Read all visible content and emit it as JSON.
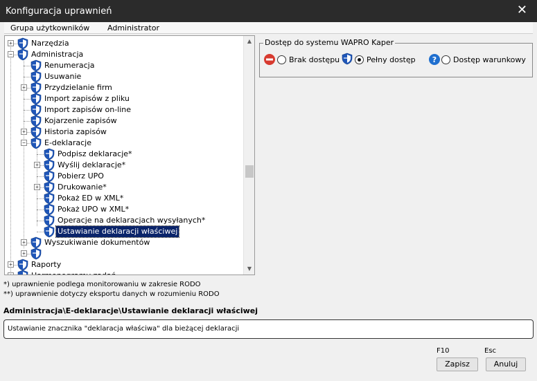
{
  "window": {
    "title": "Konfiguracja uprawnień",
    "close": "✕"
  },
  "info": {
    "label": "Grupa użytkowników",
    "value": "Administrator"
  },
  "tree": {
    "nodes": [
      {
        "label": "Narzędzia",
        "expander": "+"
      },
      {
        "label": "Administracja",
        "expander": "−"
      },
      {
        "label": "Renumeracja",
        "expander": ""
      },
      {
        "label": "Usuwanie",
        "expander": ""
      },
      {
        "label": "Przydzielanie firm",
        "expander": "+"
      },
      {
        "label": "Import zapisów z pliku",
        "expander": ""
      },
      {
        "label": "Import zapisów on-line",
        "expander": ""
      },
      {
        "label": "Kojarzenie zapisów",
        "expander": ""
      },
      {
        "label": "Historia zapisów",
        "expander": "+"
      },
      {
        "label": "E-deklaracje",
        "expander": "−"
      },
      {
        "label": "Podpisz deklaracje*",
        "expander": ""
      },
      {
        "label": "Wyślij deklaracje*",
        "expander": "+"
      },
      {
        "label": "Pobierz UPO",
        "expander": ""
      },
      {
        "label": "Drukowanie*",
        "expander": "+"
      },
      {
        "label": "Pokaż ED w XML*",
        "expander": ""
      },
      {
        "label": "Pokaż UPO w XML*",
        "expander": ""
      },
      {
        "label": "Operacje na deklaracjach wysyłanych*",
        "expander": ""
      },
      {
        "label": "Ustawianie deklaracji właściwej",
        "expander": ""
      },
      {
        "label": "Wyszukiwanie dokumentów",
        "expander": "+"
      },
      {
        "label": "",
        "expander": "+"
      },
      {
        "label": "Raporty",
        "expander": "+"
      },
      {
        "label": "Harmonogramy zadań",
        "expander": "+"
      }
    ],
    "selected_index": 17,
    "scroll_up": "▲",
    "scroll_down": "▼"
  },
  "notes": {
    "rodo": "*) uprawnienie podlega monitorowaniu w zakresie RODO",
    "export": "**) uprawnienie dotyczy eksportu danych w rozumieniu RODO"
  },
  "access": {
    "legend": "Dostęp do systemu WAPRO Kaper",
    "options": [
      {
        "label": "Brak dostępu",
        "checked": false
      },
      {
        "label": "Pełny dostęp",
        "checked": true
      },
      {
        "label": "Dostęp warunkowy",
        "checked": false
      }
    ],
    "question_glyph": "?"
  },
  "path": "Administracja\\E-deklaracje\\Ustawianie deklaracji właściwej",
  "description": "Ustawianie znacznika \"deklaracja właściwa\" dla bieżącej deklaracji",
  "buttons": {
    "save_key": "F10",
    "save_label": "Zapisz",
    "cancel_key": "Esc",
    "cancel_label": "Anuluj"
  },
  "colors": {
    "shield_blue": "#1f56b8",
    "deny_red": "#d73a2f",
    "help_blue": "#1f6fcf"
  }
}
